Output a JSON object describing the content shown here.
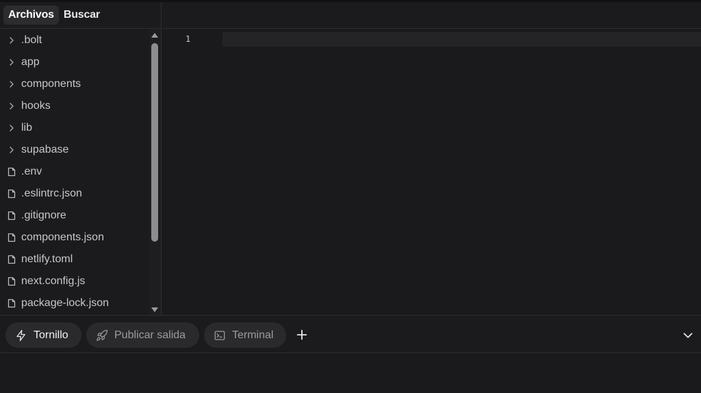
{
  "sidebar": {
    "tabs": [
      {
        "label": "Archivos",
        "active": true
      },
      {
        "label": "Buscar",
        "active": false
      }
    ],
    "items": [
      {
        "label": ".bolt",
        "type": "folder",
        "icon": "chevron-right-icon"
      },
      {
        "label": "app",
        "type": "folder",
        "icon": "chevron-right-icon"
      },
      {
        "label": "components",
        "type": "folder",
        "icon": "chevron-right-icon"
      },
      {
        "label": "hooks",
        "type": "folder",
        "icon": "chevron-right-icon"
      },
      {
        "label": "lib",
        "type": "folder",
        "icon": "chevron-right-icon"
      },
      {
        "label": "supabase",
        "type": "folder",
        "icon": "chevron-right-icon"
      },
      {
        "label": ".env",
        "type": "file",
        "icon": "file-icon"
      },
      {
        "label": ".eslintrc.json",
        "type": "file",
        "icon": "file-icon"
      },
      {
        "label": ".gitignore",
        "type": "file",
        "icon": "file-icon"
      },
      {
        "label": "components.json",
        "type": "file",
        "icon": "file-icon"
      },
      {
        "label": "netlify.toml",
        "type": "file",
        "icon": "file-icon"
      },
      {
        "label": "next.config.js",
        "type": "file",
        "icon": "file-icon"
      },
      {
        "label": "package-lock.json",
        "type": "file",
        "icon": "file-icon"
      }
    ]
  },
  "editor": {
    "line_number": "1"
  },
  "toolbar": {
    "tabs": [
      {
        "label": "Tornillo",
        "icon": "bolt-icon",
        "active": true
      },
      {
        "label": "Publicar salida",
        "icon": "rocket-icon",
        "active": false
      },
      {
        "label": "Terminal",
        "icon": "terminal-icon",
        "active": false
      }
    ],
    "add_icon": "plus-icon",
    "collapse_icon": "chevron-down-icon"
  },
  "colors": {
    "background": "#1a1a1c",
    "pill": "#2a2a2d",
    "active_text": "#f2f2f2",
    "muted_text": "#9c9c9c",
    "divider": "#2e2e31"
  }
}
